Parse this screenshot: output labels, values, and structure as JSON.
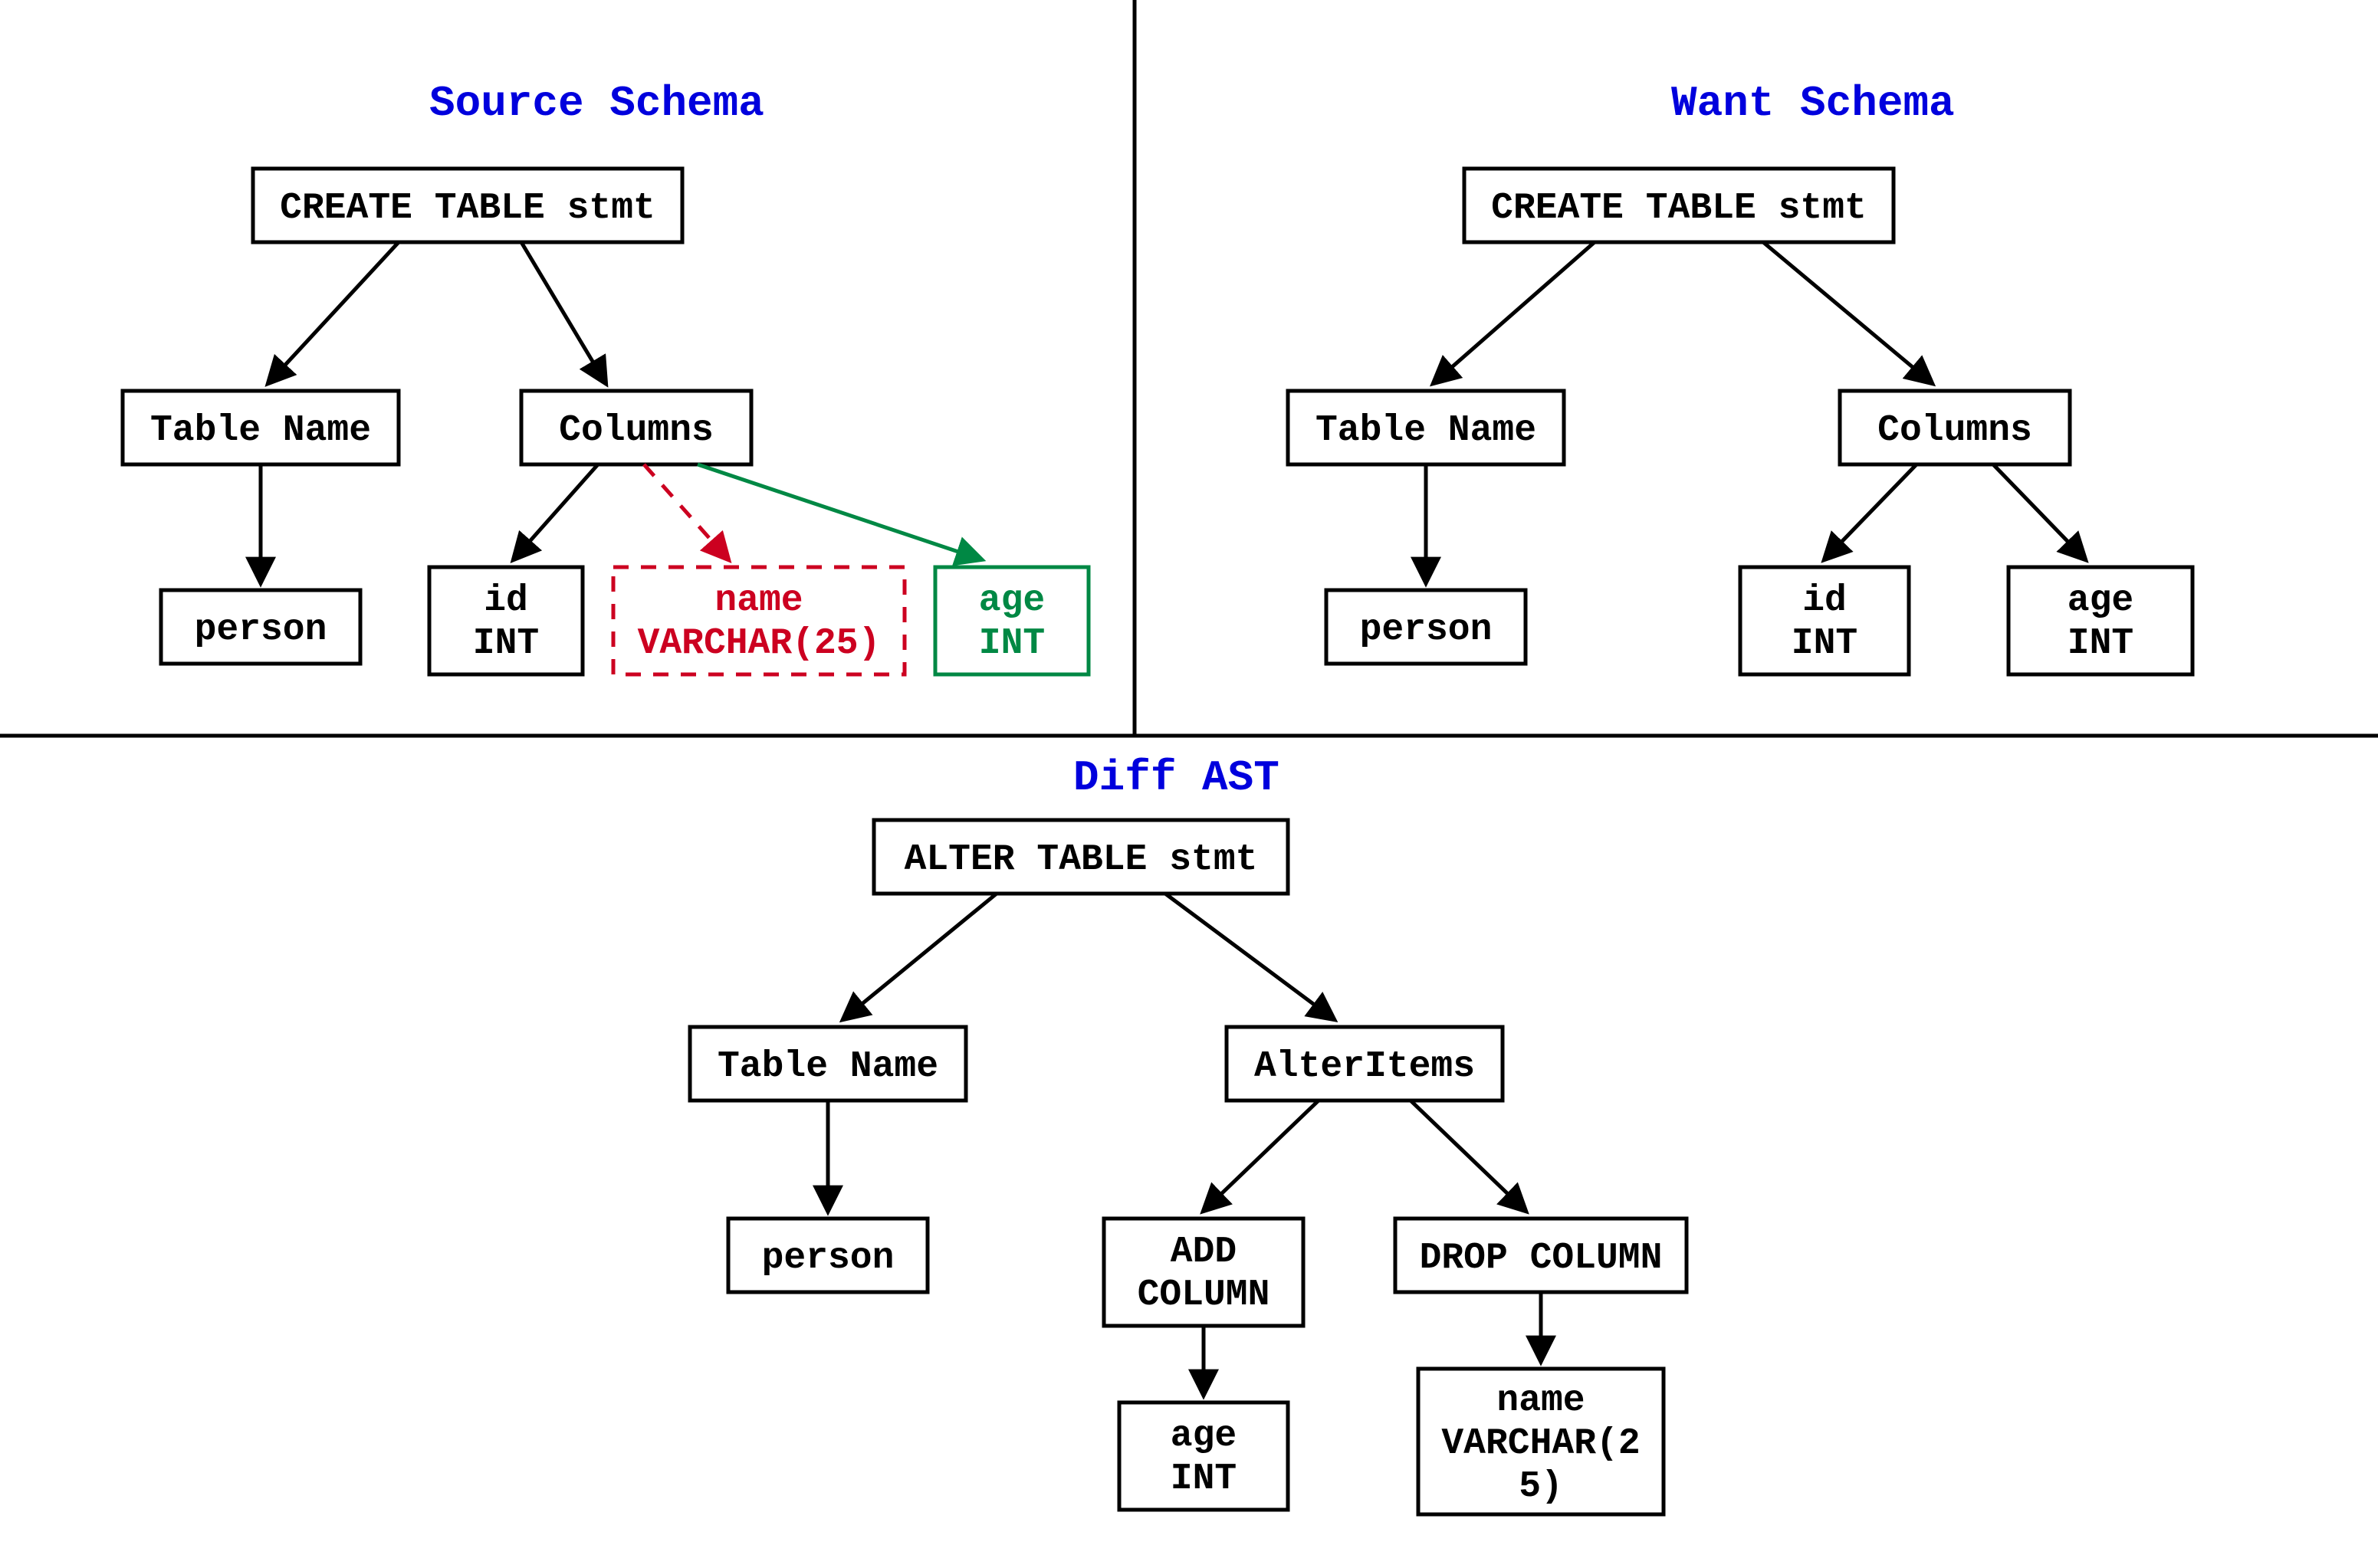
{
  "titles": {
    "source": "Source Schema",
    "want": "Want Schema",
    "diff": "Diff AST"
  },
  "source": {
    "root": "CREATE TABLE stmt",
    "tablename_label": "Table Name",
    "tablename_value": "person",
    "columns_label": "Columns",
    "col1_l1": "id",
    "col1_l2": "INT",
    "col2_l1": "name",
    "col2_l2": "VARCHAR(25)",
    "col3_l1": "age",
    "col3_l2": "INT"
  },
  "want": {
    "root": "CREATE TABLE stmt",
    "tablename_label": "Table Name",
    "tablename_value": "person",
    "columns_label": "Columns",
    "col1_l1": "id",
    "col1_l2": "INT",
    "col2_l1": "age",
    "col2_l2": "INT"
  },
  "diff": {
    "root": "ALTER TABLE stmt",
    "tablename_label": "Table Name",
    "tablename_value": "person",
    "alteritems_label": "AlterItems",
    "add_l1": "ADD",
    "add_l2": "COLUMN",
    "add_val_l1": "age",
    "add_val_l2": "INT",
    "drop_l1": "DROP COLUMN",
    "drop_val_l1": "name",
    "drop_val_l2": "VARCHAR(2",
    "drop_val_l3": "5)"
  }
}
